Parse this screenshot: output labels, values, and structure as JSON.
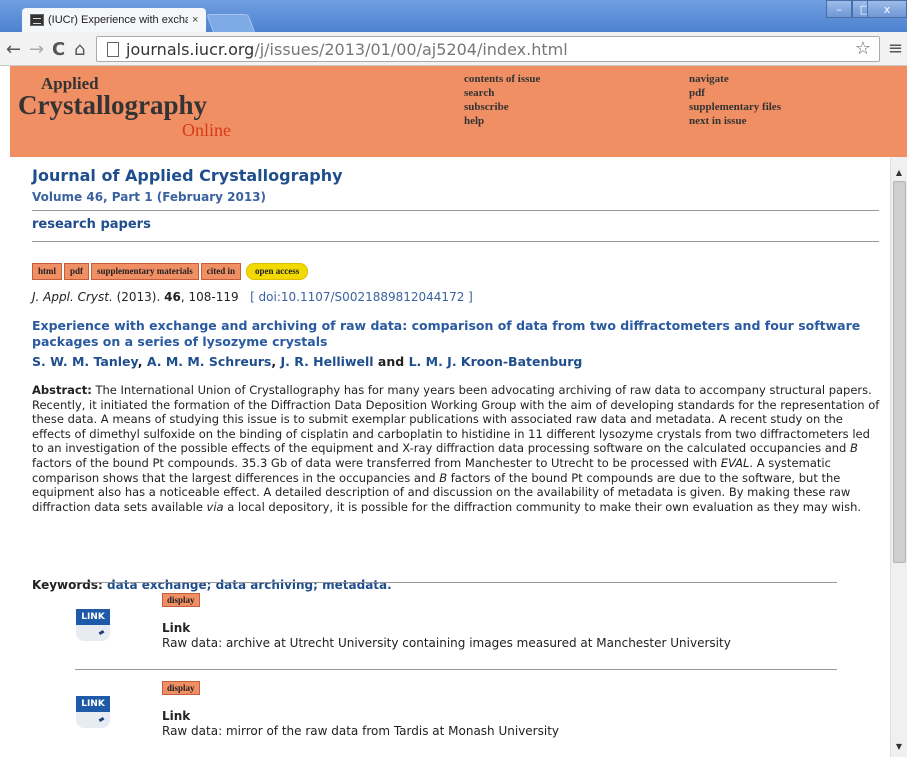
{
  "browser": {
    "tab_title": "(IUCr) Experience with excha",
    "tab_close": "×",
    "url_domain": "journals.iucr.org",
    "url_path": "/j/issues/2013/01/00/aj5204/index.html",
    "back": "←",
    "forward": "→",
    "reload": "C",
    "home": "⌂",
    "star": "☆",
    "menu": "≡",
    "win_min": "–",
    "win_max": "□",
    "win_close": "x"
  },
  "header": {
    "logo_line1": "Applied",
    "logo_line2": "Crystallography",
    "logo_line3": "Online",
    "links_col1": [
      "contents of issue",
      "search",
      "subscribe",
      "help"
    ],
    "links_col2": [
      "navigate",
      "pdf",
      "supplementary files",
      "next in issue"
    ]
  },
  "article": {
    "journal_title": "Journal of Applied Crystallography",
    "volume": "Volume 46, Part 1 (February 2013)",
    "section": "research papers",
    "tags": [
      "html",
      "pdf",
      "supplementary materials",
      "cited in"
    ],
    "open_access": "open access",
    "citation_journal": "J. Appl. Cryst.",
    "citation_year": " (2013). ",
    "citation_volume": "46",
    "citation_pages": ", 108-119",
    "doi": "[ doi:10.1107/S0021889812044172 ]",
    "title": "Experience with exchange and archiving of raw data: comparison of data from two diffractometers and four software packages on a series of lysozyme crystals",
    "authors": [
      "S. W. M. Tanley",
      "A. M. M. Schreurs",
      "J. R. Helliwell",
      "L. M. J. Kroon-Batenburg"
    ],
    "author_sep": ", ",
    "author_and": " and ",
    "abstract_label": "Abstract:",
    "abstract_p1": " The International Union of Crystallography has for many years been advocating archiving of raw data to accompany structural papers. Recently, it initiated the formation of the Diffraction Data Deposition Working Group with the aim of developing standards for the representation of these data. A means of studying this issue is to submit exemplar publications with associated raw data and metadata. A recent study on the effects of dimethyl sulfoxide on the binding of cisplatin and carboplatin to histidine in 11 different lysozyme crystals from two diffractometers led to an investigation of the possible effects of the equipment and X-ray diffraction data processing software on the calculated occupancies and ",
    "abstract_B1": "B",
    "abstract_p2": " factors of the bound Pt compounds. 35.3 Gb of data were transferred from Manchester to Utrecht to be processed with ",
    "abstract_EVAL": "EVAL",
    "abstract_p3": ". A systematic comparison shows that the largest differences in the occupancies and ",
    "abstract_B2": "B",
    "abstract_p4": " factors of the bound Pt compounds are due to the software, but the equipment also has a noticeable effect. A detailed description of and discussion on the availability of metadata is given. By making these raw diffraction data sets available ",
    "abstract_via": "via",
    "abstract_p5": " a local depository, it is possible for the diffraction community to make their own evaluation as they may wish.",
    "keywords_label": "Keywords: ",
    "keywords": "data exchange; data archiving; metadata."
  },
  "supplementary": [
    {
      "button": "display",
      "icon_text": "LINK",
      "title": "Link",
      "desc": "Raw data: archive at Utrecht University containing images measured at Manchester University"
    },
    {
      "button": "display",
      "icon_text": "LINK",
      "title": "Link",
      "desc": "Raw data: mirror of the raw data from Tardis at Monash University"
    }
  ],
  "scrollbar": {
    "up": "▲",
    "down": "▼"
  }
}
